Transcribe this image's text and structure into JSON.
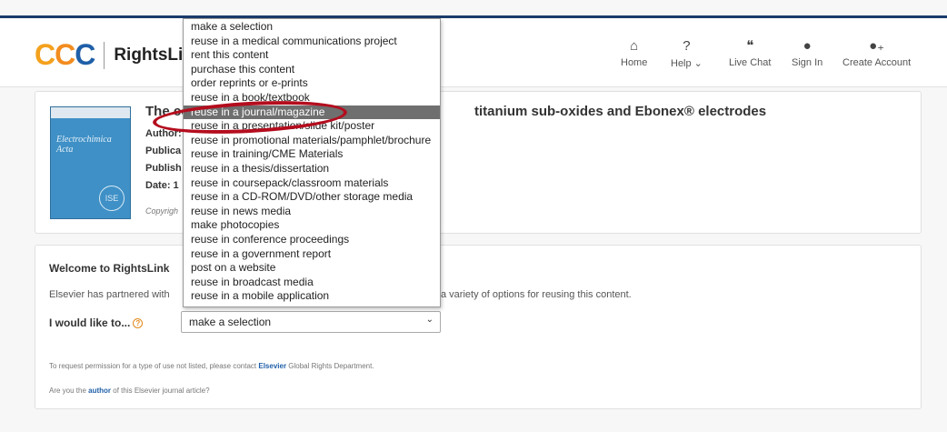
{
  "header": {
    "logo_letters": [
      "C",
      "C",
      "C"
    ],
    "logo_product": "RightsLink",
    "nav": [
      {
        "icon": "home-icon",
        "glyph": "⌂",
        "label": "Home"
      },
      {
        "icon": "help-icon",
        "glyph": "?",
        "label": "Help ⌄"
      },
      {
        "icon": "chat-icon",
        "glyph": "❝",
        "label": "Live Chat"
      },
      {
        "icon": "user-icon",
        "glyph": "●",
        "label": "Sign In"
      },
      {
        "icon": "add-user-icon",
        "glyph": "●₊",
        "label": "Create Account"
      }
    ]
  },
  "article": {
    "cover_title": "Electrochimica Acta",
    "title_start": "The co",
    "title_end": "titanium sub-oxides and Ebonex® electrodes",
    "meta_labels": [
      "Author:",
      "Publica",
      "Publish",
      "Date: 1"
    ],
    "copyright": "Copyrigh"
  },
  "welcome": {
    "title": "Welcome to RightsLink",
    "partner_start": "Elsevier has partnered with",
    "partner_end": "a variety of options for reusing this content.",
    "like_label": "I would like to...",
    "select_value": "make a selection",
    "footnote1_pre": "To request permission for a type of use not listed, please contact ",
    "footnote1_link": "Elsevier",
    "footnote1_post": " Global Rights Department.",
    "footnote2_pre": "Are you the ",
    "footnote2_link": "author",
    "footnote2_post": " of this Elsevier journal article?"
  },
  "dropdown": {
    "highlighted_index": 6,
    "options": [
      "make a selection",
      "reuse in a medical communications project",
      "rent this content",
      "purchase this content",
      "order reprints or e-prints",
      "reuse in a book/textbook",
      "reuse in a journal/magazine",
      "reuse in a presentation/slide kit/poster",
      "reuse in promotional materials/pamphlet/brochure",
      "reuse in training/CME Materials",
      "reuse in a thesis/dissertation",
      "reuse in coursepack/classroom materials",
      "reuse in a CD-ROM/DVD/other storage media",
      "reuse in news media",
      "make photocopies",
      "reuse in conference proceedings",
      "reuse in a government report",
      "post on a website",
      "reuse in broadcast media",
      "reuse in a mobile application"
    ]
  },
  "colors": {
    "accent": "#1b3a6b",
    "annotation": "#b40d1e",
    "highlight": "#6f6f6f"
  }
}
